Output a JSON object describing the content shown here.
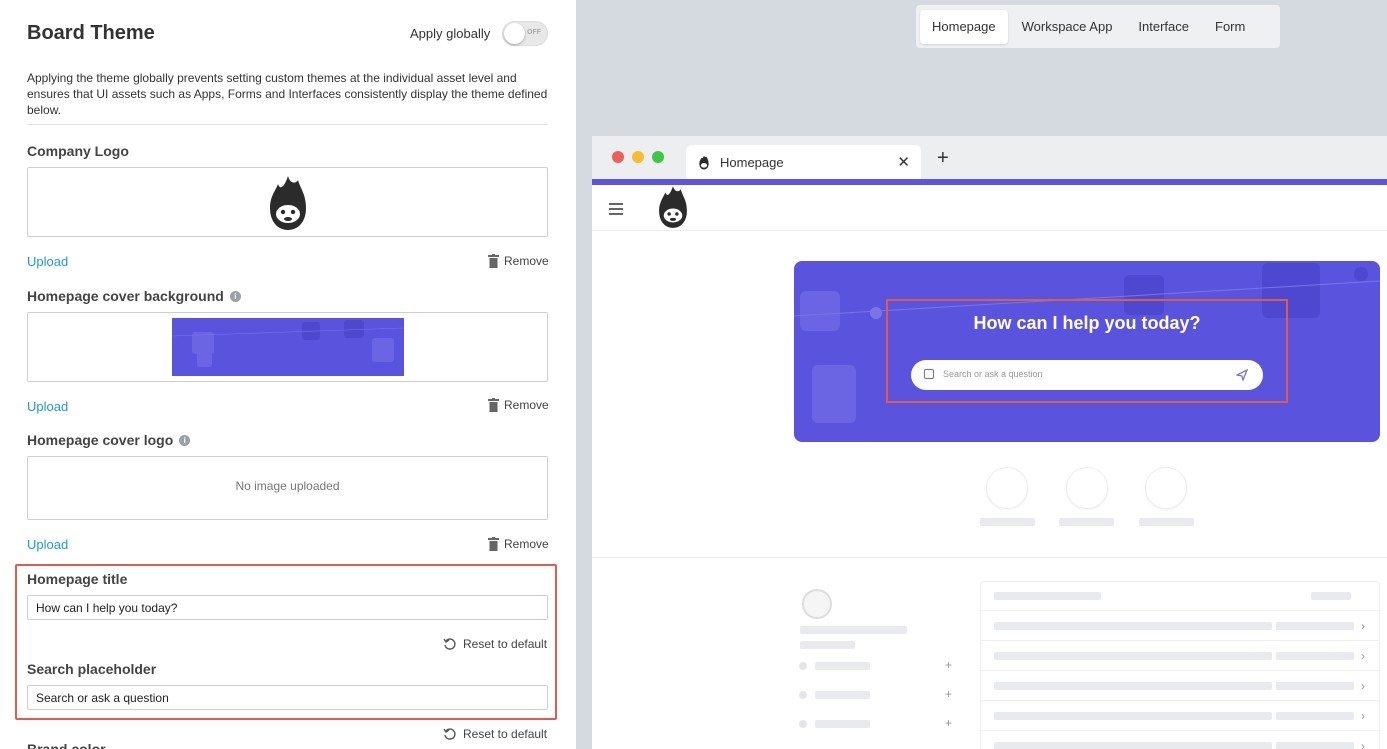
{
  "panel": {
    "title": "Board Theme",
    "apply_globally_label": "Apply globally",
    "toggle_state": "OFF",
    "description": "Applying the theme globally prevents setting custom themes at the individual asset level and ensures that UI assets such as Apps, Forms and Interfaces consistently display the theme defined below.",
    "company_logo_label": "Company Logo",
    "cover_bg_label": "Homepage cover background",
    "cover_logo_label": "Homepage cover logo",
    "no_image_text": "No image uploaded",
    "upload_label": "Upload",
    "remove_label": "Remove",
    "homepage_title_label": "Homepage title",
    "homepage_title_value": "How can I help you today?",
    "reset_label": "Reset to default",
    "search_placeholder_label": "Search placeholder",
    "search_placeholder_value": "Search or ask a question",
    "brand_color_label": "Brand color"
  },
  "preview_tabs": [
    "Homepage",
    "Workspace App",
    "Interface",
    "Form"
  ],
  "active_preview_tab": "Homepage",
  "browser": {
    "tab_title": "Homepage",
    "cover_title": "How can I help you today?",
    "search_placeholder": "Search or ask a question"
  },
  "colors": {
    "accent": "#5d56dc",
    "link": "#1c9ad6",
    "highlight": "#e05a4e"
  },
  "icons": [
    "info-icon",
    "trash-icon",
    "reset-icon",
    "flame-monkey-logo",
    "menu-icon",
    "close-icon",
    "plus-icon",
    "search-icon",
    "send-icon",
    "chevron-right-icon",
    "user-icon"
  ]
}
